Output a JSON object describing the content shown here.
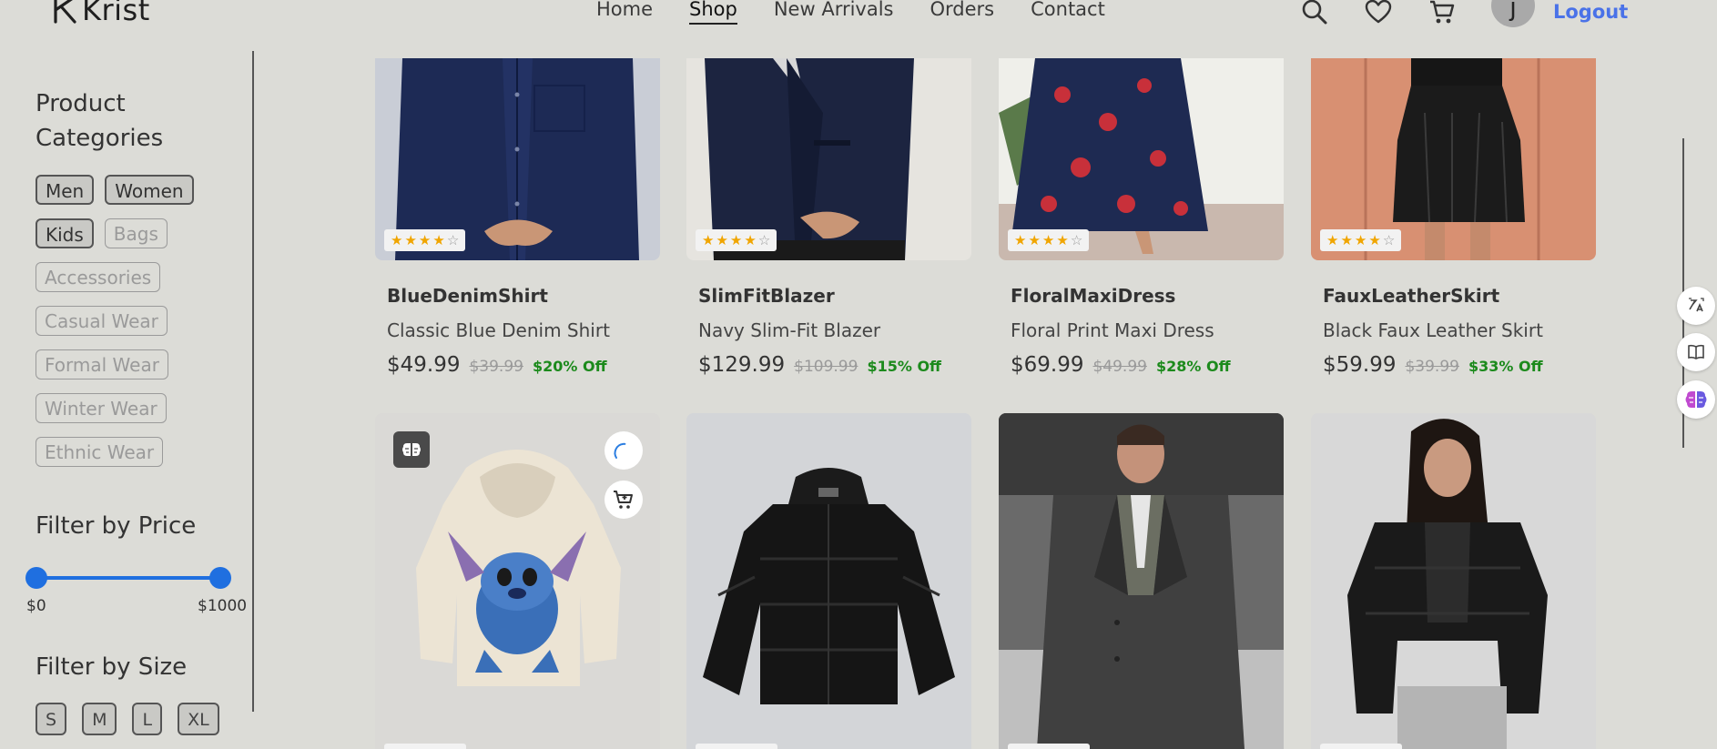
{
  "brand": {
    "name": "Krist"
  },
  "nav": {
    "items": [
      {
        "label": "Home",
        "active": false
      },
      {
        "label": "Shop",
        "active": true
      },
      {
        "label": "New Arrivals",
        "active": false
      },
      {
        "label": "Orders",
        "active": false
      },
      {
        "label": "Contact",
        "active": false
      }
    ]
  },
  "header": {
    "icons": [
      "search-icon",
      "heart-icon",
      "cart-icon"
    ],
    "avatar_initial": "j",
    "logout_label": "Logout",
    "accent_color": "#4a72e8"
  },
  "sidebar": {
    "categories_title_line1": "Product",
    "categories_title_line2": "Categories",
    "categories": [
      {
        "label": "Men",
        "selected": true
      },
      {
        "label": "Women",
        "selected": true
      },
      {
        "label": "Kids",
        "selected": true
      },
      {
        "label": "Bags",
        "selected": false
      },
      {
        "label": "Accessories",
        "selected": false
      },
      {
        "label": "Casual Wear",
        "selected": false
      },
      {
        "label": "Formal Wear",
        "selected": false
      },
      {
        "label": "Winter Wear",
        "selected": false
      },
      {
        "label": "Ethnic Wear",
        "selected": false
      }
    ],
    "price_title": "Filter by Price",
    "price_min_label": "$0",
    "price_max_label": "$1000",
    "price_range": [
      0,
      1000
    ],
    "slider_color": "#1f6fe0",
    "size_title": "Filter by Size",
    "sizes": [
      "S",
      "M",
      "L",
      "XL"
    ]
  },
  "products": [
    {
      "id": "BlueDenimShirt",
      "name": "Classic Blue Denim Shirt",
      "price": "$49.99",
      "old_price": "$39.99",
      "discount": "$20% Off",
      "rating": 4
    },
    {
      "id": "SlimFitBlazer",
      "name": "Navy Slim-Fit Blazer",
      "price": "$129.99",
      "old_price": "$109.99",
      "discount": "$15% Off",
      "rating": 4
    },
    {
      "id": "FloralMaxiDress",
      "name": "Floral Print Maxi Dress",
      "price": "$69.99",
      "old_price": "$49.99",
      "discount": "$28% Off",
      "rating": 4
    },
    {
      "id": "FauxLeatherSkirt",
      "name": "Black Faux Leather Skirt",
      "price": "$59.99",
      "old_price": "$39.99",
      "discount": "$33% Off",
      "rating": 4
    }
  ],
  "second_row_images": [
    "stitch-hoodie",
    "black-puffer-jacket",
    "grey-wool-overcoat",
    "black-puffer-jacket-women"
  ],
  "discount_color": "#1c8a1c"
}
